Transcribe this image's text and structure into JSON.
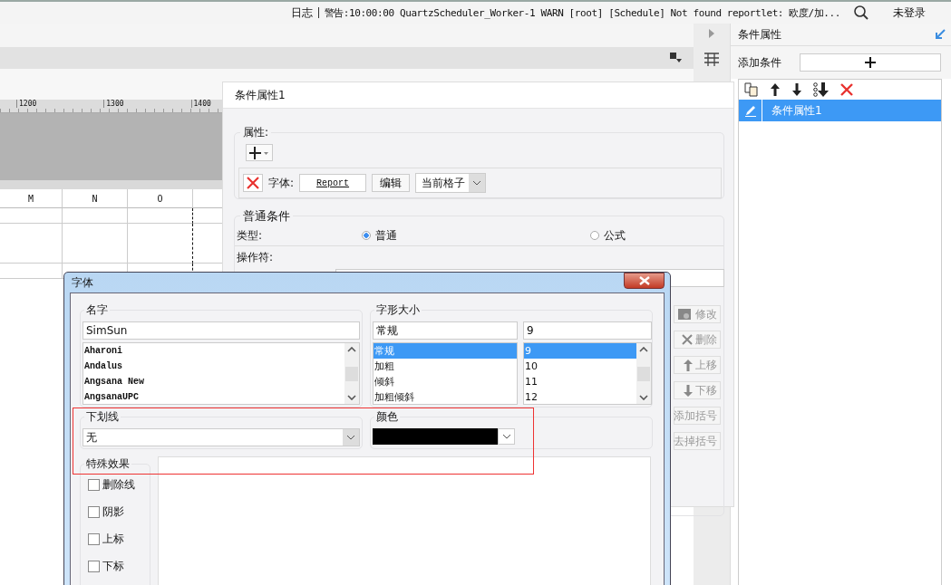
{
  "top_bar": {
    "log_label": "日志",
    "message": "警告:10:00:00 QuartzScheduler_Worker-1 WARN [root] [Schedule] Not found reportlet: 欧度/加...",
    "login": "未登录"
  },
  "sheet": {
    "ruler_ticks": [
      "1200",
      "1300",
      "1400"
    ],
    "columns": [
      "M",
      "N",
      "O"
    ]
  },
  "right_panel": {
    "title": "条件属性",
    "add_label": "添加条件",
    "conditions": [
      {
        "label": "条件属性1",
        "selected": true
      }
    ]
  },
  "condition_dialog": {
    "title": "条件属性1",
    "properties_legend": "属性:",
    "font_label": "字体:",
    "font_preview": "Report",
    "edit_button": "编辑",
    "scope": "当前格子",
    "general_legend": "普通条件",
    "type_label": "类型:",
    "types": [
      {
        "label": "普通",
        "selected": true
      },
      {
        "label": "公式",
        "selected": false
      }
    ],
    "operator_label": "操作符:",
    "buttons": [
      {
        "label": "修改",
        "disabled": true,
        "kind": "gear"
      },
      {
        "label": "删除",
        "disabled": true,
        "kind": "cross"
      },
      {
        "label": "上移",
        "disabled": true,
        "kind": "up"
      },
      {
        "label": "下移",
        "disabled": true,
        "kind": "down"
      },
      {
        "label": "添加括号",
        "disabled": true,
        "kind": "none"
      },
      {
        "label": "去掉括号",
        "disabled": true,
        "kind": "none"
      }
    ]
  },
  "font_dialog": {
    "title": "字体",
    "name_legend": "名字",
    "name_value": "SimSun",
    "fonts": [
      {
        "label": "Aharoni",
        "selected": false
      },
      {
        "label": "Andalus",
        "selected": false
      },
      {
        "label": "Angsana New",
        "selected": false
      },
      {
        "label": "AngsanaUPC",
        "selected": false
      }
    ],
    "style_legend": "字形大小",
    "style_value": "常规",
    "styles": [
      {
        "label": "常规",
        "selected": true
      },
      {
        "label": "加粗",
        "selected": false
      },
      {
        "label": "倾斜",
        "selected": false
      },
      {
        "label": "加粗倾斜",
        "selected": false
      }
    ],
    "size_value": "9",
    "sizes": [
      {
        "label": "9",
        "selected": true
      },
      {
        "label": "10",
        "selected": false
      },
      {
        "label": "11",
        "selected": false
      },
      {
        "label": "12",
        "selected": false
      }
    ],
    "underline_legend": "下划线",
    "underline_value": "无",
    "color_legend": "颜色",
    "color": "#000000",
    "effects_legend": "特殊效果",
    "effects": [
      {
        "label": "删除线",
        "checked": false
      },
      {
        "label": "阴影",
        "checked": false
      },
      {
        "label": "上标",
        "checked": false
      },
      {
        "label": "下标",
        "checked": false
      }
    ]
  }
}
